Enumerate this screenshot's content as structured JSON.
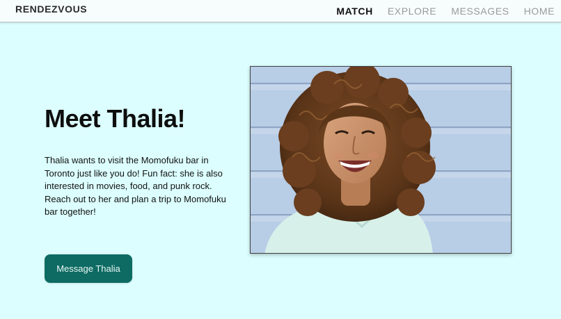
{
  "nav": {
    "brand": "RENDEZVOUS",
    "links": [
      "MATCH",
      "EXPLORE",
      "MESSAGES",
      "HOME"
    ],
    "active_link": "MATCH"
  },
  "profile": {
    "title": "Meet Thalia!",
    "description": "Thalia wants to visit the Momofuku bar in Toronto just like you do! Fun fact: she is also interested in movies, food, and punk rock. Reach out to her and plan a trip to Momofuku bar together!",
    "cta_label": "Message Thalia"
  },
  "colors": {
    "background": "#dcfefe",
    "accent": "#0d6b63",
    "wall": "#b8cde6"
  }
}
